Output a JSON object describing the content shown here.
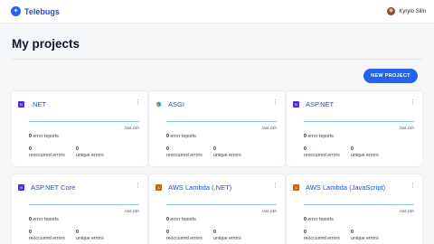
{
  "app": {
    "name": "Telebugs",
    "logo_icon": "bug-star-icon",
    "accent": "#2563eb"
  },
  "user": {
    "name": "Kyrylo Silin"
  },
  "page": {
    "title": "My projects",
    "new_project_label": "NEW PROJECT"
  },
  "labels": {
    "period": "last 24h",
    "error_reports": "error reports",
    "reoccurred_errors": "reoccurred errors",
    "unique_errors": "unique errors"
  },
  "projects": [
    {
      "name": ".NET",
      "icon": "dotnet-icon",
      "error_reports": "0",
      "reoccurred": "0",
      "unique": "0"
    },
    {
      "name": "ASGI",
      "icon": "asgi-icon",
      "error_reports": "0",
      "reoccurred": "0",
      "unique": "0"
    },
    {
      "name": "ASP.NET",
      "icon": "dotnet-icon",
      "error_reports": "0",
      "reoccurred": "0",
      "unique": "0"
    },
    {
      "name": "ASP.NET Core",
      "icon": "dotnet-icon",
      "error_reports": "0",
      "reoccurred": "0",
      "unique": "0"
    },
    {
      "name": "AWS Lambda (.NET)",
      "icon": "aws-lambda-icon",
      "error_reports": "0",
      "reoccurred": "0",
      "unique": "0"
    },
    {
      "name": "AWS Lambda (JavaScript)",
      "icon": "aws-lambda-icon",
      "error_reports": "0",
      "reoccurred": "0",
      "unique": "0"
    }
  ]
}
